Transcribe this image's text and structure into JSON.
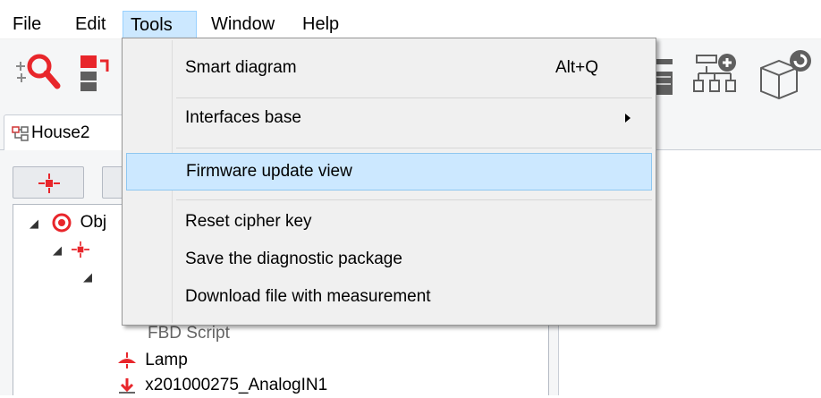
{
  "menubar": {
    "items": [
      {
        "label": "File"
      },
      {
        "label": "Edit"
      },
      {
        "label": "Tools"
      },
      {
        "label": "Window"
      },
      {
        "label": "Help"
      }
    ],
    "active": "Tools"
  },
  "document_tab": {
    "label": "House2"
  },
  "tree": {
    "rows": [
      {
        "label": "Obj"
      },
      {
        "label": "FBD Script"
      },
      {
        "label": "Lamp"
      },
      {
        "label": "x201000275_AnalogIN1"
      }
    ]
  },
  "tools_menu": {
    "items": [
      {
        "label": "Smart diagram",
        "shortcut": "Alt+Q"
      },
      {
        "label": "Interfaces base",
        "has_submenu": true
      },
      {
        "label": "Firmware update view",
        "highlighted": true
      },
      {
        "label": "Reset cipher key"
      },
      {
        "label": "Save the diagnostic package"
      },
      {
        "label": "Download file with measurement"
      }
    ]
  },
  "colors": {
    "menu_highlight": "#cce8ff",
    "menu_highlight_border": "#99d1ff",
    "icon_red": "#e8262b",
    "icon_gray": "#5f5f5f"
  }
}
